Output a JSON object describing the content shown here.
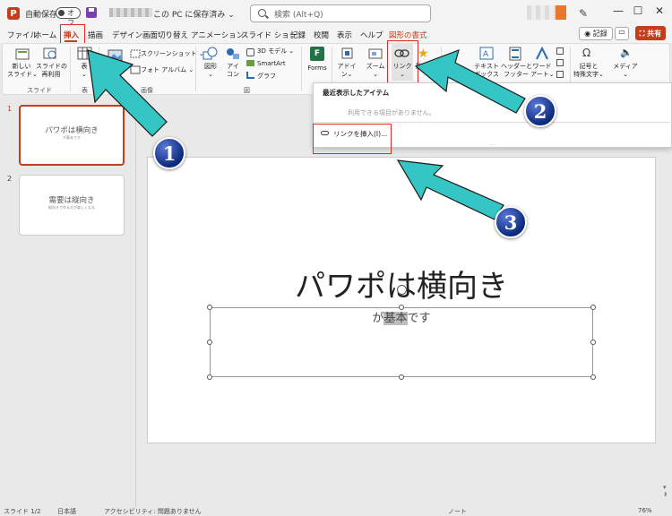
{
  "titlebar": {
    "autosave_label": "自動保存",
    "autosave_state": "オフ",
    "doc_title": "この PC に保存済み ⌄",
    "search_placeholder": "検索 (Alt+Q)",
    "minimize": "—",
    "maximize": "☐",
    "close": "✕"
  },
  "menu": {
    "tabs": [
      "ファイル",
      "ホーム",
      "挿入",
      "描画",
      "デザイン",
      "画面切り替え",
      "アニメーション",
      "スライド ショー",
      "記録",
      "校閲",
      "表示",
      "ヘルプ",
      "図形の書式"
    ],
    "active_tab": "挿入",
    "record_label": "◉ 記録",
    "share_label": "⛶ 共有"
  },
  "ribbon": {
    "new_slide": "新しい\nスライド⌄",
    "reuse_slide": "スライドの\n再利用",
    "table": "表\n⌄",
    "screenshot": "スクリーンショット ⌄",
    "photo_album": "フォト アルバム ⌄",
    "shapes": "図形\n⌄",
    "icons": "アイ\nコン",
    "models_3d": "3D モデル ⌄",
    "smartart": "SmartArt",
    "chart": "グラフ",
    "forms": "Forms",
    "addins": "アドイ\nン⌄",
    "zoom": "ズーム\n⌄",
    "link": "リンク\n⌄",
    "action": "動作",
    "textbox": "テキスト\nボックス",
    "header_footer": "ヘッダーと\nフッター",
    "wordart": "ワード\nアート⌄",
    "symbols": "記号と\n特殊文字⌄",
    "media": "メディア\n⌄",
    "group_slides": "スライド",
    "group_tables": "表",
    "group_images": "画像",
    "group_illustrations": "図"
  },
  "dropdown": {
    "recent_title": "最近表示したアイテム",
    "recent_empty": "利用できる項目がありません。",
    "insert_link": "リンクを挿入(I)..."
  },
  "thumbnails": [
    {
      "num": "1",
      "title": "パワポは横向き",
      "sub": "が基本です"
    },
    {
      "num": "2",
      "title": "需要は縦向き",
      "sub": "縦向きで作る方が楽しくなる"
    }
  ],
  "slide": {
    "title": "パワポは横向き",
    "sub_before": "が",
    "sub_highlight": "基本",
    "sub_after": "です"
  },
  "statusbar": {
    "slide_indicator": "スライド 1/2",
    "language": "日本語",
    "accessibility": "アクセシビリティ: 問題ありません",
    "notes": "ノート",
    "zoom": "76%"
  },
  "callouts": [
    "1",
    "2",
    "3"
  ],
  "colors": {
    "accent": "#c43e1c",
    "arrow": "#35c5c5",
    "highlight_box": "#e02b2b"
  }
}
